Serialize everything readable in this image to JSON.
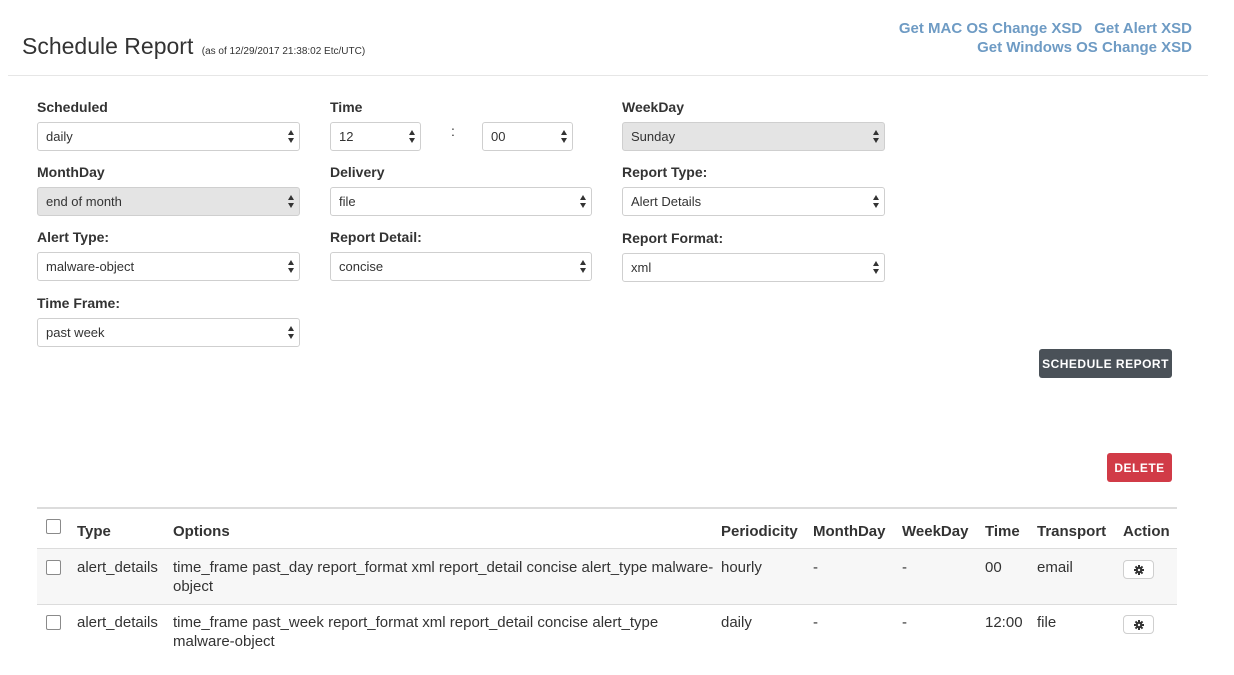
{
  "header": {
    "title": "Schedule Report",
    "as_of": "(as of 12/29/2017 21:38:02 Etc/UTC)",
    "links": [
      "Get MAC OS Change XSD",
      "Get Alert XSD",
      "Get Windows OS Change XSD"
    ]
  },
  "form": {
    "scheduled": {
      "label": "Scheduled",
      "value": "daily"
    },
    "time": {
      "label": "Time",
      "hour": "12",
      "separator": ":",
      "minute": "00"
    },
    "weekday": {
      "label": "WeekDay",
      "value": "Sunday",
      "disabled": true
    },
    "monthday": {
      "label": "MonthDay",
      "value": "end of month",
      "disabled": true
    },
    "delivery": {
      "label": "Delivery",
      "value": "file"
    },
    "report_type": {
      "label": "Report Type:",
      "value": "Alert Details"
    },
    "alert_type": {
      "label": "Alert Type:",
      "value": "malware-object"
    },
    "report_detail": {
      "label": "Report Detail:",
      "value": "concise"
    },
    "report_format": {
      "label": "Report Format:",
      "value": "xml"
    },
    "time_frame": {
      "label": "Time Frame:",
      "value": "past week"
    },
    "schedule_button": "SCHEDULE REPORT"
  },
  "delete_button": "DELETE",
  "table": {
    "columns": [
      "Type",
      "Options",
      "Periodicity",
      "MonthDay",
      "WeekDay",
      "Time",
      "Transport",
      "Action"
    ],
    "rows": [
      {
        "type": "alert_details",
        "options_line1": "time_frame past_day report_format xml report_detail concise alert_type malware-",
        "options_line2": "object",
        "periodicity": "hourly",
        "monthday": "-",
        "weekday": "-",
        "time": "00",
        "transport": "email"
      },
      {
        "type": "alert_details",
        "options_line1": "time_frame past_week report_format xml report_detail concise alert_type",
        "options_line2": "malware-object",
        "periodicity": "daily",
        "monthday": "-",
        "weekday": "-",
        "time": "12:00",
        "transport": "file"
      }
    ]
  },
  "colors": {
    "link": "#6e9bc4",
    "schedule_button": "#4a5158",
    "delete_button": "#d13b47",
    "disabled_select": "#e4e4e4"
  },
  "icons": {
    "select_arrows": "updown-arrows-icon",
    "row_action": "gear-icon"
  }
}
